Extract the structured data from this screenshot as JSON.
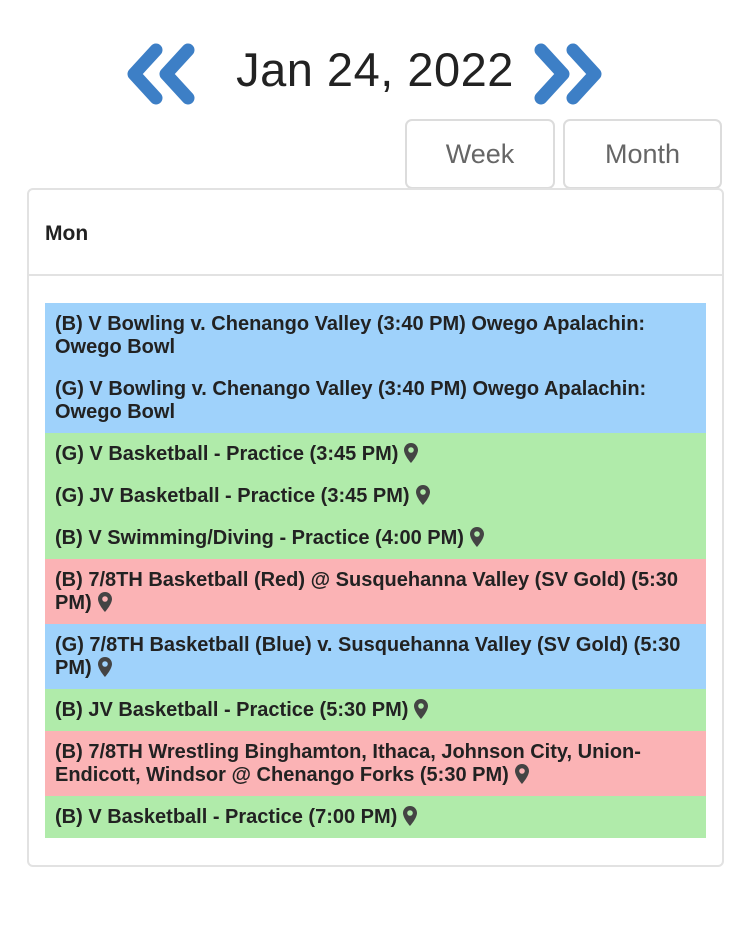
{
  "header": {
    "date_title": "Jan 24, 2022",
    "prev_icon": "double-chevron-left-icon",
    "next_icon": "double-chevron-right-icon",
    "accent_color": "#3d7fc6"
  },
  "views": {
    "week_label": "Week",
    "month_label": "Month"
  },
  "calendar": {
    "day_label": "Mon",
    "events": [
      {
        "text": "(B) V Bowling v. Chenango Valley (3:40 PM) Owego Apalachin: Owego Bowl",
        "color": "#9fd2fb",
        "has_location": false
      },
      {
        "text": "(G) V Bowling v. Chenango Valley (3:40 PM) Owego Apalachin: Owego Bowl",
        "color": "#9fd2fb",
        "has_location": false
      },
      {
        "text": "(G) V Basketball - Practice (3:45 PM)",
        "color": "#b0ebaa",
        "has_location": true
      },
      {
        "text": "(G) JV Basketball - Practice (3:45 PM)",
        "color": "#b0ebaa",
        "has_location": true
      },
      {
        "text": "(B) V Swimming/Diving - Practice (4:00 PM)",
        "color": "#b0ebaa",
        "has_location": true
      },
      {
        "text": "(B) 7/8TH Basketball (Red) @ Susquehanna Valley (SV Gold) (5:30 PM)",
        "color": "#fbb3b5",
        "has_location": true
      },
      {
        "text": "(G) 7/8TH Basketball (Blue) v. Susquehanna Valley (SV Gold) (5:30 PM)",
        "color": "#9fd2fb",
        "has_location": true
      },
      {
        "text": "(B) JV Basketball - Practice (5:30 PM)",
        "color": "#b0ebaa",
        "has_location": true
      },
      {
        "text": "(B) 7/8TH Wrestling Binghamton, Ithaca, Johnson City, Union-Endicott, Windsor @ Chenango Forks (5:30 PM)",
        "color": "#fbb3b5",
        "has_location": true
      },
      {
        "text": "(B) V Basketball - Practice (7:00 PM)",
        "color": "#b0ebaa",
        "has_location": true
      }
    ],
    "location_icon": "map-pin-icon"
  }
}
